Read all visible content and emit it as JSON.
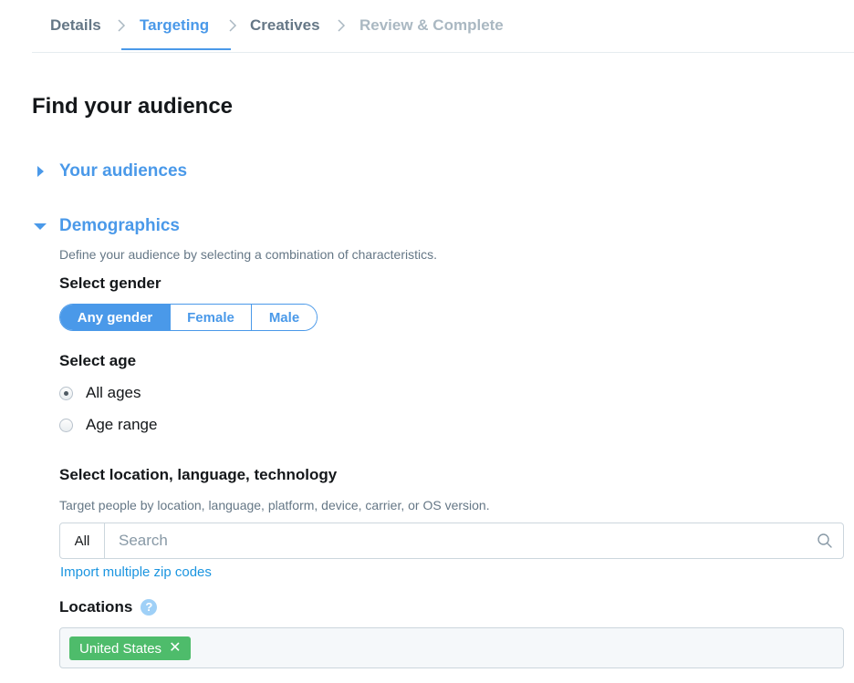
{
  "steps": [
    {
      "label": "Details",
      "state": "done"
    },
    {
      "label": "Targeting",
      "state": "active"
    },
    {
      "label": "Creatives",
      "state": "done"
    },
    {
      "label": "Review & Complete",
      "state": "todo"
    }
  ],
  "page_title": "Find your audience",
  "sections": {
    "your_audiences": {
      "label": "Your audiences",
      "expanded": false,
      "icon": "caret-right-icon"
    },
    "demographics": {
      "label": "Demographics",
      "expanded": true,
      "icon": "caret-down-icon",
      "description": "Define your audience by selecting a combination of characteristics.",
      "gender": {
        "label": "Select gender",
        "options": [
          "Any gender",
          "Female",
          "Male"
        ],
        "selected": "Any gender"
      },
      "age": {
        "label": "Select age",
        "options": [
          "All ages",
          "Age range"
        ],
        "selected": "All ages"
      },
      "targeting": {
        "label": "Select location, language, technology",
        "description": "Target people by location, language, platform, device, carrier, or OS version.",
        "scope": "All",
        "search_placeholder": "Search",
        "search_value": "",
        "import_link": "Import multiple zip codes"
      },
      "locations": {
        "label": "Locations",
        "help": "?",
        "tags": [
          "United States"
        ]
      }
    }
  },
  "colors": {
    "accent": "#4a99e9",
    "tag_green": "#4ebc6b",
    "muted": "#657786",
    "disabled": "#aab8c2"
  }
}
